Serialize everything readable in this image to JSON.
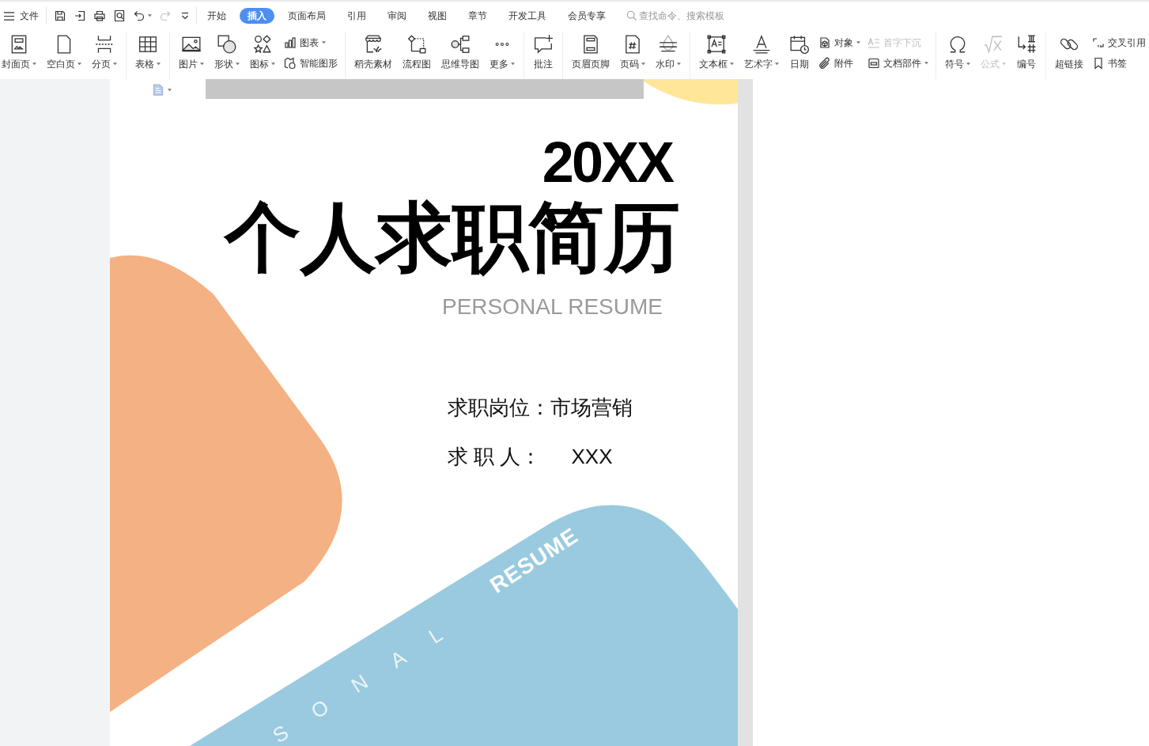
{
  "toolbar": {
    "menu_label": "文件",
    "quick_access": [
      {
        "kind": "save",
        "has_menu": false,
        "disabled": false
      },
      {
        "kind": "export",
        "has_menu": false,
        "disabled": false
      },
      {
        "kind": "print",
        "has_menu": false,
        "disabled": false
      },
      {
        "kind": "preview",
        "has_menu": false,
        "disabled": false
      },
      {
        "kind": "undo",
        "has_menu": true,
        "disabled": false
      },
      {
        "kind": "redo",
        "has_menu": false,
        "disabled": true
      },
      {
        "kind": "customize",
        "has_menu": false,
        "disabled": false
      }
    ],
    "tabs": [
      {
        "label": "开始",
        "selected": false
      },
      {
        "label": "插入",
        "selected": true
      },
      {
        "label": "页面布局",
        "selected": false
      },
      {
        "label": "引用",
        "selected": false
      },
      {
        "label": "审阅",
        "selected": false
      },
      {
        "label": "视图",
        "selected": false
      },
      {
        "label": "章节",
        "selected": false
      },
      {
        "label": "开发工具",
        "selected": false
      },
      {
        "label": "会员专享",
        "selected": false
      }
    ],
    "search": {
      "placeholder": "查找命令、搜索模板"
    }
  },
  "ribbon": {
    "groups": [
      {
        "items": [
          {
            "kind": "large",
            "label": "封面页",
            "has_menu": true,
            "disabled": false
          },
          {
            "kind": "large",
            "label": "空白页",
            "has_menu": true,
            "disabled": false
          },
          {
            "kind": "large",
            "label": "分页",
            "has_menu": true,
            "disabled": false
          }
        ]
      },
      {
        "items": [
          {
            "kind": "large",
            "label": "表格",
            "has_menu": true,
            "disabled": false
          }
        ]
      },
      {
        "items": [
          {
            "kind": "large",
            "label": "图片",
            "has_menu": true,
            "disabled": false
          },
          {
            "kind": "large",
            "label": "形状",
            "has_menu": true,
            "disabled": false
          },
          {
            "kind": "large",
            "label": "图标",
            "has_menu": true,
            "disabled": false
          },
          {
            "kind": "stack",
            "entries": [
              {
                "label": "图表",
                "has_menu": true,
                "disabled": false
              },
              {
                "label": "智能图形",
                "has_menu": false,
                "disabled": false
              }
            ]
          }
        ]
      },
      {
        "items": [
          {
            "kind": "large",
            "label": "稻壳素材",
            "has_menu": false,
            "disabled": false
          },
          {
            "kind": "large",
            "label": "流程图",
            "has_menu": false,
            "disabled": false
          },
          {
            "kind": "large",
            "label": "思维导图",
            "has_menu": false,
            "disabled": false
          },
          {
            "kind": "large",
            "label": "更多",
            "has_menu": true,
            "disabled": false
          }
        ]
      },
      {
        "items": [
          {
            "kind": "large",
            "label": "批注",
            "has_menu": false,
            "disabled": false
          }
        ]
      },
      {
        "items": [
          {
            "kind": "large",
            "label": "页眉页脚",
            "has_menu": false,
            "disabled": false
          },
          {
            "kind": "large",
            "label": "页码",
            "has_menu": true,
            "disabled": false
          },
          {
            "kind": "large",
            "label": "水印",
            "has_menu": true,
            "disabled": false
          }
        ]
      },
      {
        "items": [
          {
            "kind": "large",
            "label": "文本框",
            "has_menu": true,
            "disabled": false
          },
          {
            "kind": "large",
            "label": "艺术字",
            "has_menu": true,
            "disabled": false
          },
          {
            "kind": "large",
            "label": "日期",
            "has_menu": false,
            "disabled": false
          },
          {
            "kind": "stack",
            "entries": [
              {
                "label": "对象",
                "has_menu": true,
                "disabled": false
              },
              {
                "label": "附件",
                "has_menu": false,
                "disabled": false
              }
            ]
          },
          {
            "kind": "stack",
            "entries": [
              {
                "label": "首字下沉",
                "has_menu": false,
                "disabled": true
              },
              {
                "label": "文档部件",
                "has_menu": true,
                "disabled": false
              }
            ]
          }
        ]
      },
      {
        "items": [
          {
            "kind": "large",
            "label": "符号",
            "has_menu": true,
            "disabled": false
          },
          {
            "kind": "large",
            "label": "公式",
            "has_menu": true,
            "disabled": true
          },
          {
            "kind": "large",
            "label": "编号",
            "has_menu": false,
            "disabled": false
          }
        ]
      },
      {
        "items": [
          {
            "kind": "large",
            "label": "超链接",
            "has_menu": false,
            "disabled": false
          },
          {
            "kind": "stack",
            "entries": [
              {
                "label": "交叉引用",
                "has_menu": false,
                "disabled": false
              },
              {
                "label": "书签",
                "has_menu": false,
                "disabled": false
              }
            ]
          }
        ]
      }
    ]
  },
  "document": {
    "year": "20XX",
    "title": "个人求职简历",
    "subtitle": "PERSONAL RESUME",
    "position_line": "求职岗位：市场营销",
    "applicant": {
      "label": "求 职 人：",
      "value": "XXX"
    },
    "diagonal_bold": "RESUME",
    "diagonal_spaced": "SONAL"
  }
}
